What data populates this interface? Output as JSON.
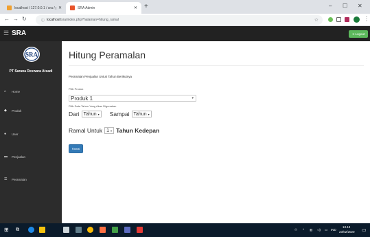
{
  "browser": {
    "tabs": [
      {
        "title": "localhost / 127.0.0.1 / sra / penj",
        "active": false
      },
      {
        "title": "SRA Admin",
        "active": true
      }
    ],
    "new_tab": "+",
    "address": {
      "host": "localhost",
      "path": "/sra/index.php?halaman=hitung_ramal"
    },
    "window_controls": {
      "minimize": "–",
      "maximize": "☐",
      "close": "✕"
    }
  },
  "navbar": {
    "brand": "SRA",
    "logout_label": "Logout"
  },
  "sidebar": {
    "logo_text": "SRA",
    "company": "PT Sarana Reswara Atsadi",
    "items": [
      {
        "icon": "home-icon",
        "glyph": "⌂",
        "label": "Home"
      },
      {
        "icon": "tag-icon",
        "glyph": "◆",
        "label": "Produk"
      },
      {
        "icon": "user-icon",
        "glyph": "●",
        "label": "User"
      },
      {
        "icon": "cart-icon",
        "glyph": "▬",
        "label": "Penjualan"
      },
      {
        "icon": "list-icon",
        "glyph": "☰",
        "label": "Peramalan"
      }
    ]
  },
  "main": {
    "title": "Hitung Peramalan",
    "subtitle": "Peramalan Penjualan Untuk Tahun Berikutnya",
    "product_label": "Pilih Produk",
    "product_value": "Produk 1",
    "years_label": "Pilih Data Tahun Yang Akan Digunakan",
    "from_label": "Dari",
    "from_value": "Tahun",
    "to_label": "Sampai",
    "to_value": "Tahun",
    "forecast_label": "Ramal Untuk",
    "forecast_value": "1",
    "forecast_suffix": "Tahun Kedepan",
    "submit_label": "Ramal"
  },
  "taskbar": {
    "lang": "IND",
    "time": "13.13",
    "date": "23/02/2020"
  },
  "colors": {
    "navbar": "#222222",
    "sidebar": "#2c2c2c",
    "logout": "#5cb85c",
    "primary": "#337ab7",
    "taskbar": "#0b1b2b"
  }
}
